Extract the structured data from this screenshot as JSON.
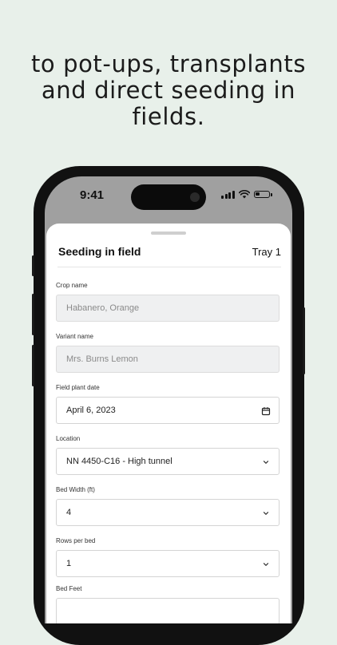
{
  "headline": {
    "line1": "to pot-ups, transplants",
    "line2": "and direct seeding in",
    "line3": "fields."
  },
  "status_bar": {
    "time": "9:41",
    "battery_level": 0.3
  },
  "sheet": {
    "title": "Seeding in field",
    "tray": "Tray 1"
  },
  "form": {
    "crop_name": {
      "label": "Crop name",
      "value": "Habanero, Orange"
    },
    "variant_name": {
      "label": "Variant name",
      "value": "Mrs. Burns Lemon"
    },
    "field_plant_date": {
      "label": "Field plant date",
      "value": "April 6, 2023"
    },
    "location": {
      "label": "Location",
      "value": "NN 4450-C16 - High tunnel"
    },
    "bed_width": {
      "label": "Bed Width (ft)",
      "value": "4"
    },
    "rows_per_bed": {
      "label": "Rows per bed",
      "value": "1"
    },
    "bed_feet": {
      "label": "Bed Feet",
      "value": ""
    }
  },
  "icons": {
    "date": "calendar-icon",
    "dropdown": "chevron-down-icon"
  }
}
